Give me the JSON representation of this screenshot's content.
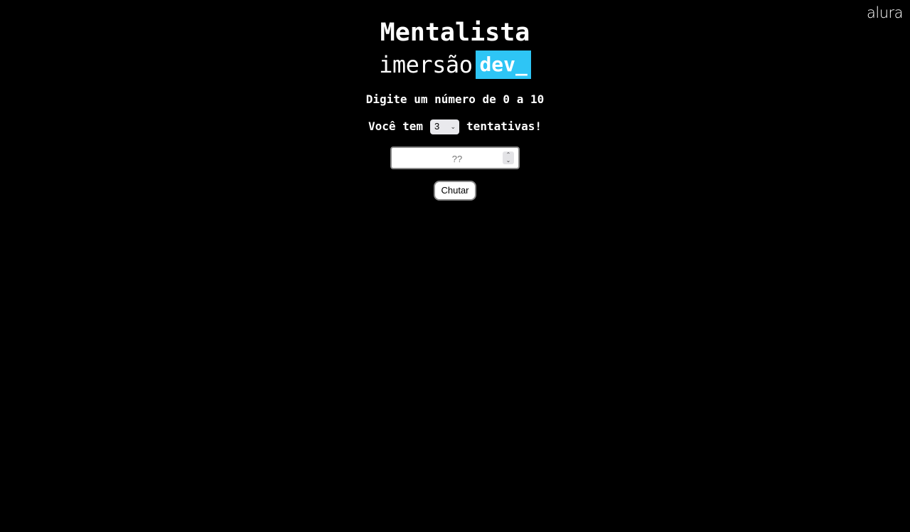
{
  "brand": {
    "logo_text": "alura"
  },
  "header": {
    "title": "Mentalista",
    "logo_word": "imersão",
    "logo_highlight": "dev_"
  },
  "game": {
    "prompt": "Digite um número de 0 a 10",
    "attempts_prefix": "Você tem",
    "attempts_value": "3",
    "attempts_suffix": "tentativas!",
    "guess_placeholder": "??",
    "guess_button_label": "Chutar"
  },
  "colors": {
    "background": "#000000",
    "accent": "#2ec5f5",
    "text": "#ffffff"
  },
  "icons": {
    "select_chevron": "chevron-down-icon",
    "number_spinner": "spinner-arrows-icon"
  }
}
